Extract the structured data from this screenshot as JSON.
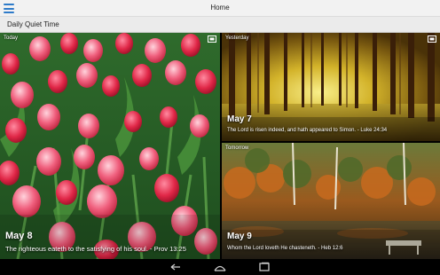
{
  "app": {
    "title": "Home"
  },
  "section": {
    "title": "Daily Quiet Time"
  },
  "tiles": {
    "today": {
      "label": "Today",
      "date": "May 8",
      "verse": "The righteous eateth to the satisfying of his soul. - Prov 13:25"
    },
    "yesterday": {
      "label": "Yesterday",
      "date": "May 7",
      "verse": "The Lord is risen indeed, and hath appeared to Simon. - Luke 24:34"
    },
    "tomorrow": {
      "label": "Tomorrow",
      "date": "May 9",
      "verse": "Whom the Lord loveth He chasteneth. - Heb 12:6"
    }
  },
  "icons": {
    "menu": "hamburger-menu-icon",
    "expand": "expand-icon",
    "back": "back-icon",
    "home": "home-icon",
    "recents": "recent-apps-icon"
  },
  "colors": {
    "accent": "#2e7bc9"
  }
}
